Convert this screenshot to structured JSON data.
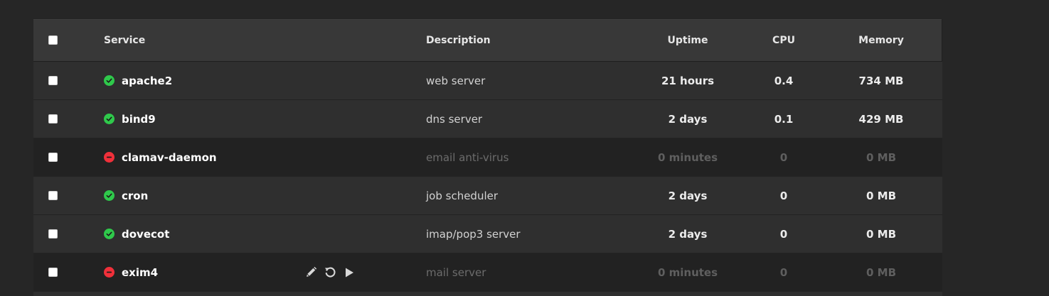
{
  "colors": {
    "page_bg": "#262626",
    "header_bg": "#383838",
    "row_running_bg": "#2f2f2f",
    "row_stopped_bg": "#222222",
    "status_ok": "#2fc94b",
    "status_err": "#f0303a"
  },
  "table": {
    "headers": {
      "service": "Service",
      "description": "Description",
      "uptime": "Uptime",
      "cpu": "CPU",
      "memory": "Memory"
    },
    "rows": [
      {
        "name": "apache2",
        "status": "running",
        "status_icon": "check-circle-icon",
        "description": "web server",
        "uptime": "21 hours",
        "cpu": "0.4",
        "memory": "734 MB"
      },
      {
        "name": "bind9",
        "status": "running",
        "status_icon": "check-circle-icon",
        "description": "dns server",
        "uptime": "2 days",
        "cpu": "0.1",
        "memory": "429 MB"
      },
      {
        "name": "clamav-daemon",
        "status": "stopped",
        "status_icon": "minus-circle-icon",
        "description": "email anti-virus",
        "uptime": "0 minutes",
        "cpu": "0",
        "memory": "0 MB"
      },
      {
        "name": "cron",
        "status": "running",
        "status_icon": "check-circle-icon",
        "description": "job scheduler",
        "uptime": "2 days",
        "cpu": "0",
        "memory": "0 MB"
      },
      {
        "name": "dovecot",
        "status": "running",
        "status_icon": "check-circle-icon",
        "description": "imap/pop3 server",
        "uptime": "2 days",
        "cpu": "0",
        "memory": "0 MB"
      },
      {
        "name": "exim4",
        "status": "stopped",
        "status_icon": "minus-circle-icon",
        "description": "mail server",
        "uptime": "0 minutes",
        "cpu": "0",
        "memory": "0 MB",
        "actions": [
          "edit-pencil-icon",
          "restart-icon",
          "start-play-icon"
        ]
      }
    ]
  }
}
